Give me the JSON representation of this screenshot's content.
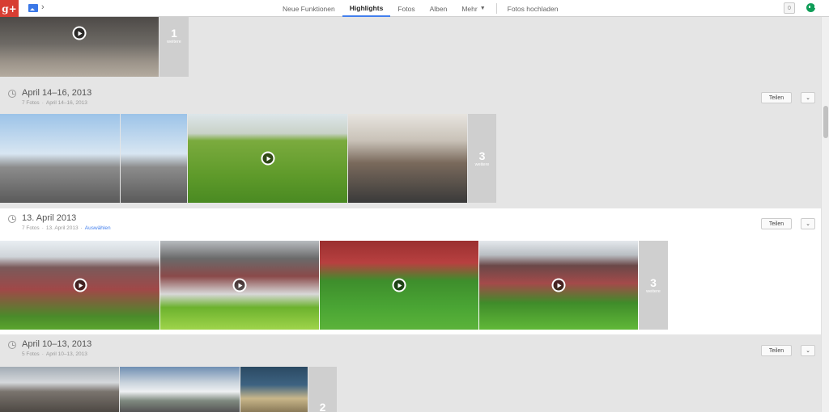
{
  "header": {
    "logo_text": "g+",
    "app_icon": "photos-icon",
    "nav": [
      {
        "label": "Neue Funktionen",
        "active": false
      },
      {
        "label": "Highlights",
        "active": true
      },
      {
        "label": "Fotos",
        "active": false
      },
      {
        "label": "Alben",
        "active": false
      },
      {
        "label": "Mehr",
        "active": false
      }
    ],
    "upload_label": "Fotos hochladen",
    "notification_count": "0"
  },
  "colors": {
    "accent": "#427fed",
    "gplus_red": "#d73d32",
    "hangouts_green": "#0f9d58"
  },
  "top_section": {
    "more_count": "1",
    "more_label": "weitere"
  },
  "sections": [
    {
      "title": "April 14–16, 2013",
      "photo_count": "7 Fotos",
      "date": "April 14–16, 2013",
      "select_label": "",
      "share_label": "Teilen",
      "more_count": "3",
      "more_label": "weitere"
    },
    {
      "title": "13. April 2013",
      "photo_count": "7 Fotos",
      "date": "13. April 2013",
      "select_label": "Auswählen",
      "share_label": "Teilen",
      "more_count": "3",
      "more_label": "weitere"
    },
    {
      "title": "April 10–13, 2013",
      "photo_count": "5 Fotos",
      "date": "April 10–13, 2013",
      "select_label": "",
      "share_label": "Teilen",
      "more_count": "2",
      "more_label": "weitere"
    }
  ]
}
